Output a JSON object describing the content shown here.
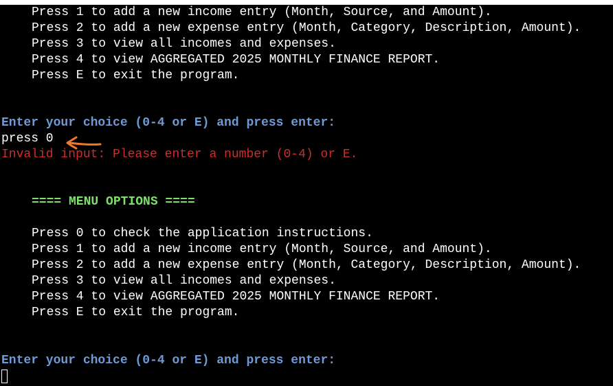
{
  "first_menu": {
    "items": [
      "Press 1 to add a new income entry (Month, Source, and Amount).",
      "Press 2 to add a new expense entry (Month, Category, Description, Amount).",
      "Press 3 to view all incomes and expenses.",
      "Press 4 to view AGGREGATED 2025 MONTHLY FINANCE REPORT.",
      "Press E to exit the program."
    ]
  },
  "first_prompt": "Enter your choice (0-4 or E) and press enter:",
  "user_input": "press 0",
  "error_message": "Invalid input: Please enter a number (0-4) or E.",
  "second_menu": {
    "header": "==== MENU OPTIONS ====",
    "items": [
      "Press 0 to check the application instructions.",
      "Press 1 to add a new income entry (Month, Source, and Amount).",
      "Press 2 to add a new expense entry (Month, Category, Description, Amount).",
      "Press 3 to view all incomes and expenses.",
      "Press 4 to view AGGREGATED 2025 MONTHLY FINANCE REPORT.",
      "Press E to exit the program."
    ]
  },
  "second_prompt": "Enter your choice (0-4 or E) and press enter:",
  "colors": {
    "background": "#000000",
    "text": "#ffffff",
    "prompt": "#6f9ad8",
    "error": "#d22b2b",
    "header": "#7ee06a",
    "annotation": "#f07a2a"
  },
  "annotation_icon": "arrow-left-icon"
}
